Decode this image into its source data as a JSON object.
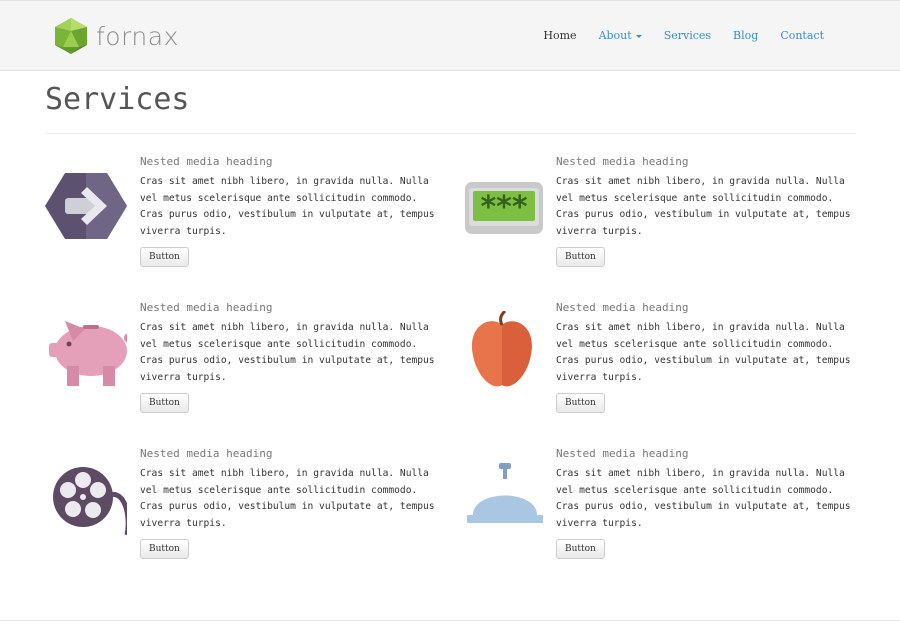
{
  "brand": {
    "name": "fornax"
  },
  "nav": {
    "items": [
      {
        "label": "Home",
        "active": true
      },
      {
        "label": "About",
        "dropdown": true
      },
      {
        "label": "Services"
      },
      {
        "label": "Blog"
      },
      {
        "label": "Contact"
      }
    ]
  },
  "page": {
    "title": "Services"
  },
  "media_items": [
    {
      "icon": "arrow-hexagon-icon",
      "heading": "Nested media heading",
      "text": "Cras sit amet nibh libero, in gravida nulla. Nulla vel metus scelerisque ante sollicitudin commodo. Cras purus odio, vestibulum in vulputate at, tempus viverra turpis.",
      "button": "Button"
    },
    {
      "icon": "password-icon",
      "heading": "Nested media heading",
      "text": "Cras sit amet nibh libero, in gravida nulla. Nulla vel metus scelerisque ante sollicitudin commodo. Cras purus odio, vestibulum in vulputate at, tempus viverra turpis.",
      "button": "Button"
    },
    {
      "icon": "piggy-bank-icon",
      "heading": "Nested media heading",
      "text": "Cras sit amet nibh libero, in gravida nulla. Nulla vel metus scelerisque ante sollicitudin commodo. Cras purus odio, vestibulum in vulputate at, tempus viverra turpis.",
      "button": "Button"
    },
    {
      "icon": "apple-icon",
      "heading": "Nested media heading",
      "text": "Cras sit amet nibh libero, in gravida nulla. Nulla vel metus scelerisque ante sollicitudin commodo. Cras purus odio, vestibulum in vulputate at, tempus viverra turpis.",
      "button": "Button"
    },
    {
      "icon": "film-reel-icon",
      "heading": "Nested media heading",
      "text": "Cras sit amet nibh libero, in gravida nulla. Nulla vel metus scelerisque ante sollicitudin commodo. Cras purus odio, vestibulum in vulputate at, tempus viverra turpis.",
      "button": "Button"
    },
    {
      "icon": "service-bell-icon",
      "heading": "Nested media heading",
      "text": "Cras sit amet nibh libero, in gravida nulla. Nulla vel metus scelerisque ante sollicitudin commodo. Cras purus odio, vestibulum in vulputate at, tempus viverra turpis.",
      "button": "Button"
    }
  ],
  "colors": {
    "link": "#3a8fc9",
    "navbar_bg": "#f5f5f5",
    "logo_green": "#8cc63f"
  }
}
